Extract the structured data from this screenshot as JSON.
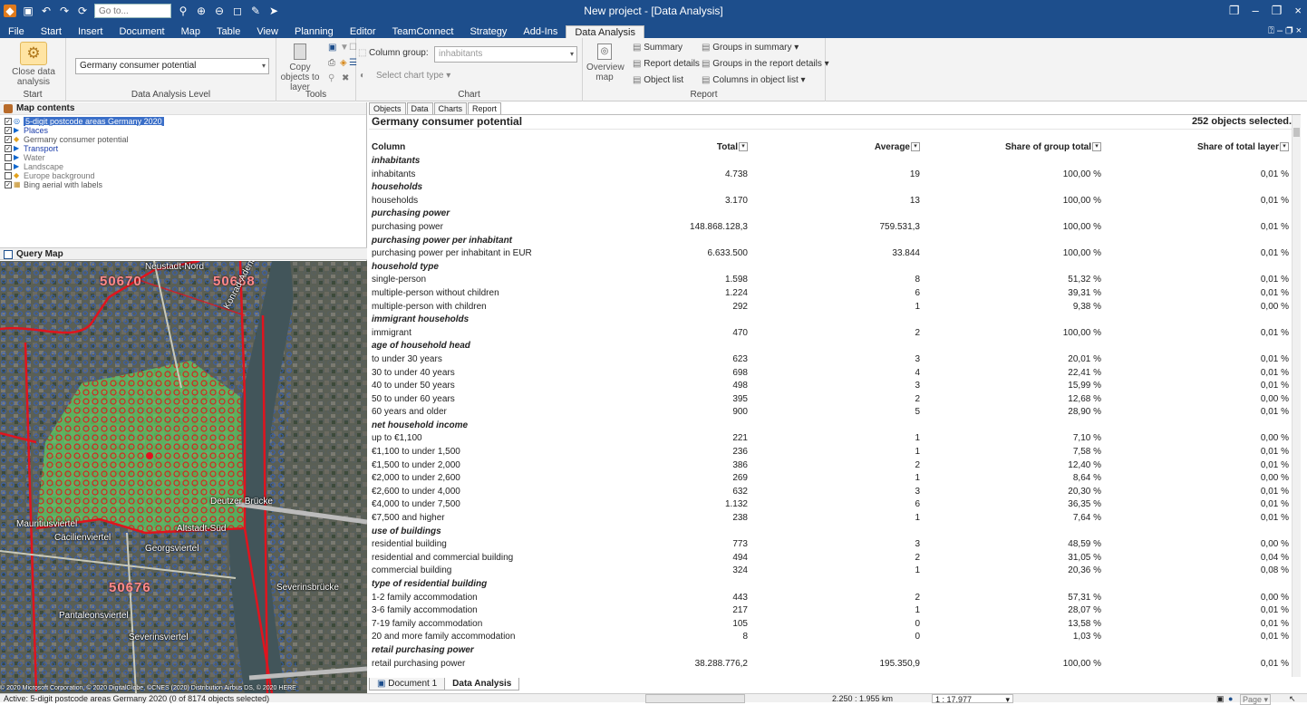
{
  "title_bar": {
    "goto_placeholder": "Go to...",
    "window_title": "New project - [Data Analysis]",
    "min": "–",
    "restore": "❐",
    "close": "×"
  },
  "menu": {
    "tabs": [
      "File",
      "Start",
      "Insert",
      "Document",
      "Map",
      "Table",
      "View",
      "Planning",
      "Editor",
      "TeamConnect",
      "Strategy",
      "Add-Ins",
      "Data Analysis"
    ],
    "active": "Data Analysis",
    "right": "⍰ – ❐ ×"
  },
  "ribbon": {
    "start": {
      "close_label": "Close data analysis",
      "group": "Start"
    },
    "level": {
      "selected": "Germany consumer potential",
      "group": "Data Analysis Level"
    },
    "tools": {
      "copy_label": "Copy objects to layer",
      "group": "Tools"
    },
    "chart": {
      "column_group_label": "Column group:",
      "column_group_value": "inhabitants",
      "chart_type": "Select chart type",
      "group": "Chart"
    },
    "report": {
      "overview_map": "Overview map",
      "summary": "Summary",
      "report_details": "Report details",
      "object_list": "Object list",
      "groups_in_summary": "Groups in summary",
      "groups_in_report_details": "Groups in the report details",
      "columns_in_object_list": "Columns in object list",
      "group": "Report"
    }
  },
  "map_contents": {
    "header": "Map contents",
    "layers": [
      {
        "label": "5-digit postcode areas Germany 2020",
        "checked": true,
        "style": "sel"
      },
      {
        "label": "Places",
        "checked": true,
        "style": "blue"
      },
      {
        "label": "Germany consumer potential",
        "checked": true,
        "style": "norm"
      },
      {
        "label": "Transport",
        "checked": true,
        "style": "blue"
      },
      {
        "label": "Water",
        "checked": false,
        "style": "gray"
      },
      {
        "label": "Landscape",
        "checked": false,
        "style": "gray"
      },
      {
        "label": "Europe background",
        "checked": false,
        "style": "gray"
      },
      {
        "label": "Bing aerial with labels",
        "checked": true,
        "style": "norm"
      }
    ]
  },
  "query_map": {
    "header": "Query Map",
    "postcodes": [
      "50670",
      "50668",
      "50676"
    ],
    "places": [
      "Neustadt-Nord",
      "Deutzer Brücke",
      "Mauritiusviertel",
      "Cäcilienviertel",
      "Altstadt-Süd",
      "Georgsviertel",
      "Pantaleonsviertel",
      "Severinsviertel",
      "Severinsbrücke",
      "Konrad-Adenauer-Ufer"
    ],
    "copyright": "© 2020 Microsoft Corporation, © 2020 DigitalGlobe, ©CNES (2020) Distribution Airbus DS, © 2020 HERE"
  },
  "report": {
    "subtabs": [
      "Objects",
      "Data",
      "Charts",
      "Report"
    ],
    "active_subtab": "Report",
    "title": "Germany consumer potential",
    "selected_count": "252 objects selected.",
    "columns": [
      "Column",
      "Total",
      "Average",
      "Share of group total",
      "Share of total layer"
    ],
    "rows": [
      {
        "g": "inhabitants"
      },
      {
        "c": [
          "inhabitants",
          "4.738",
          "19",
          "100,00 %",
          "0,01 %"
        ]
      },
      {
        "g": "households"
      },
      {
        "c": [
          "households",
          "3.170",
          "13",
          "100,00 %",
          "0,01 %"
        ]
      },
      {
        "g": "purchasing power"
      },
      {
        "c": [
          "purchasing power",
          "148.868.128,3",
          "759.531,3",
          "100,00 %",
          "0,01 %"
        ]
      },
      {
        "g": "purchasing power per inhabitant"
      },
      {
        "c": [
          "purchasing power per inhabitant in EUR",
          "6.633.500",
          "33.844",
          "100,00 %",
          "0,01 %"
        ]
      },
      {
        "g": "household type"
      },
      {
        "c": [
          "single-person",
          "1.598",
          "8",
          "51,32 %",
          "0,01 %"
        ]
      },
      {
        "c": [
          "multiple-person without children",
          "1.224",
          "6",
          "39,31 %",
          "0,01 %"
        ]
      },
      {
        "c": [
          "multiple-person with children",
          "292",
          "1",
          "9,38 %",
          "0,00 %"
        ]
      },
      {
        "g": "immigrant households"
      },
      {
        "c": [
          "immigrant",
          "470",
          "2",
          "100,00 %",
          "0,01 %"
        ]
      },
      {
        "g": "age of household head"
      },
      {
        "c": [
          "to under 30 years",
          "623",
          "3",
          "20,01 %",
          "0,01 %"
        ]
      },
      {
        "c": [
          "30 to under 40 years",
          "698",
          "4",
          "22,41 %",
          "0,01 %"
        ]
      },
      {
        "c": [
          "40 to under 50 years",
          "498",
          "3",
          "15,99 %",
          "0,01 %"
        ]
      },
      {
        "c": [
          "50 to under 60 years",
          "395",
          "2",
          "12,68 %",
          "0,00 %"
        ]
      },
      {
        "c": [
          "60 years and older",
          "900",
          "5",
          "28,90 %",
          "0,01 %"
        ]
      },
      {
        "g": "net household income"
      },
      {
        "c": [
          "up to €1,100",
          "221",
          "1",
          "7,10 %",
          "0,00 %"
        ]
      },
      {
        "c": [
          "€1,100 to under 1,500",
          "236",
          "1",
          "7,58 %",
          "0,01 %"
        ]
      },
      {
        "c": [
          "€1,500 to under 2,000",
          "386",
          "2",
          "12,40 %",
          "0,01 %"
        ]
      },
      {
        "c": [
          "€2,000 to under 2,600",
          "269",
          "1",
          "8,64 %",
          "0,00 %"
        ]
      },
      {
        "c": [
          "€2,600 to under 4,000",
          "632",
          "3",
          "20,30 %",
          "0,01 %"
        ]
      },
      {
        "c": [
          "€4,000 to under 7,500",
          "1.132",
          "6",
          "36,35 %",
          "0,01 %"
        ]
      },
      {
        "c": [
          "€7,500 and higher",
          "238",
          "1",
          "7,64 %",
          "0,01 %"
        ]
      },
      {
        "g": "use of buildings"
      },
      {
        "c": [
          "residential building",
          "773",
          "3",
          "48,59 %",
          "0,00 %"
        ]
      },
      {
        "c": [
          "residential and commercial building",
          "494",
          "2",
          "31,05 %",
          "0,04 %"
        ]
      },
      {
        "c": [
          "commercial building",
          "324",
          "1",
          "20,36 %",
          "0,08 %"
        ]
      },
      {
        "g": "type of residential building"
      },
      {
        "c": [
          "1-2 family accommodation",
          "443",
          "2",
          "57,31 %",
          "0,00 %"
        ]
      },
      {
        "c": [
          "3-6 family accommodation",
          "217",
          "1",
          "28,07 %",
          "0,01 %"
        ]
      },
      {
        "c": [
          "7-19 family accommodation",
          "105",
          "0",
          "13,58 %",
          "0,01 %"
        ]
      },
      {
        "c": [
          "20 and more family accommodation",
          "8",
          "0",
          "1,03 %",
          "0,01 %"
        ]
      },
      {
        "g": "retail purchasing power"
      },
      {
        "c": [
          "retail purchasing power",
          "38.288.776,2",
          "195.350,9",
          "100,00 %",
          "0,01 %"
        ]
      }
    ],
    "doc_tabs": [
      "Document 1",
      "Data Analysis"
    ],
    "active_doc_tab": "Data Analysis"
  },
  "status": {
    "active_text": "Active: 5-digit postcode areas Germany 2020 (0 of 8174 objects selected)",
    "scale_km": "2.250 : 1.955 km",
    "scale": "1 : 17.977",
    "page_label": "Page"
  },
  "colors": {
    "titlebar": "#1d4e8c",
    "selection": "#3b6fc8",
    "postcode_border": "#e0141e",
    "selected_area": "#5fcf5f"
  }
}
